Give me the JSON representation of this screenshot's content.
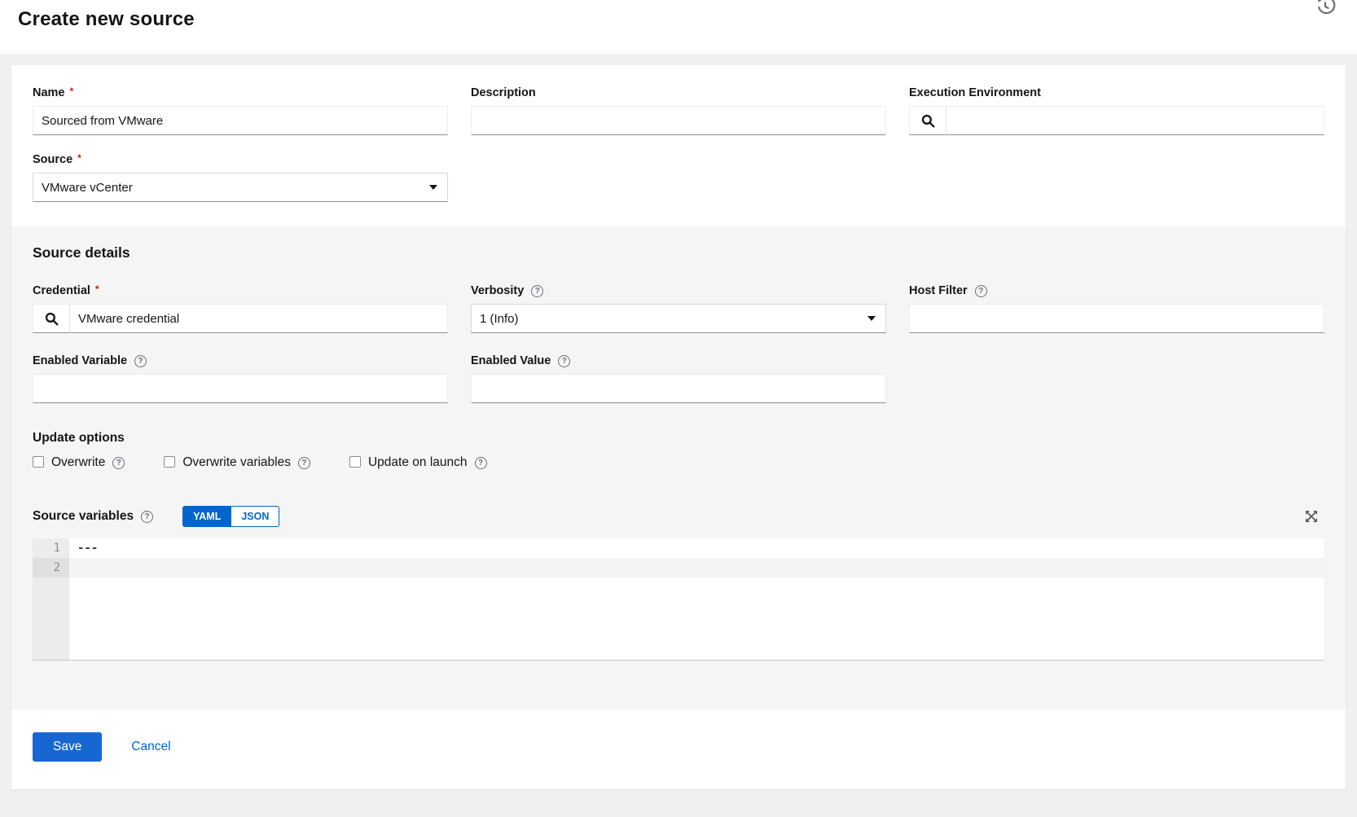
{
  "title": "Create new source",
  "ui": {
    "required_marker": "*"
  },
  "form": {
    "name": {
      "label": "Name",
      "value": "Sourced from VMware"
    },
    "description": {
      "label": "Description",
      "value": ""
    },
    "execution_environment": {
      "label": "Execution Environment",
      "value": ""
    },
    "source": {
      "label": "Source",
      "value": "VMware vCenter"
    }
  },
  "source_details": {
    "heading": "Source details",
    "credential": {
      "label": "Credential",
      "value": "VMware credential"
    },
    "verbosity": {
      "label": "Verbosity",
      "value": "1 (Info)"
    },
    "host_filter": {
      "label": "Host Filter",
      "value": ""
    },
    "enabled_variable": {
      "label": "Enabled Variable",
      "value": ""
    },
    "enabled_value": {
      "label": "Enabled Value",
      "value": ""
    },
    "update_options": {
      "heading": "Update options",
      "checkboxes": [
        {
          "label": "Overwrite",
          "checked": false
        },
        {
          "label": "Overwrite variables",
          "checked": false
        },
        {
          "label": "Update on launch",
          "checked": false
        }
      ]
    },
    "source_variables": {
      "label": "Source variables",
      "modes": [
        "YAML",
        "JSON"
      ],
      "selected_mode": "YAML",
      "editor": {
        "lines": [
          {
            "number": "1",
            "content": "---"
          },
          {
            "number": "2",
            "content": ""
          }
        ]
      }
    }
  },
  "actions": {
    "save": "Save",
    "cancel": "Cancel"
  },
  "colors": {
    "primary": "#1767d2",
    "link": "#0066cc",
    "required": "#c9190b",
    "band_bg": "#f5f5f5"
  }
}
